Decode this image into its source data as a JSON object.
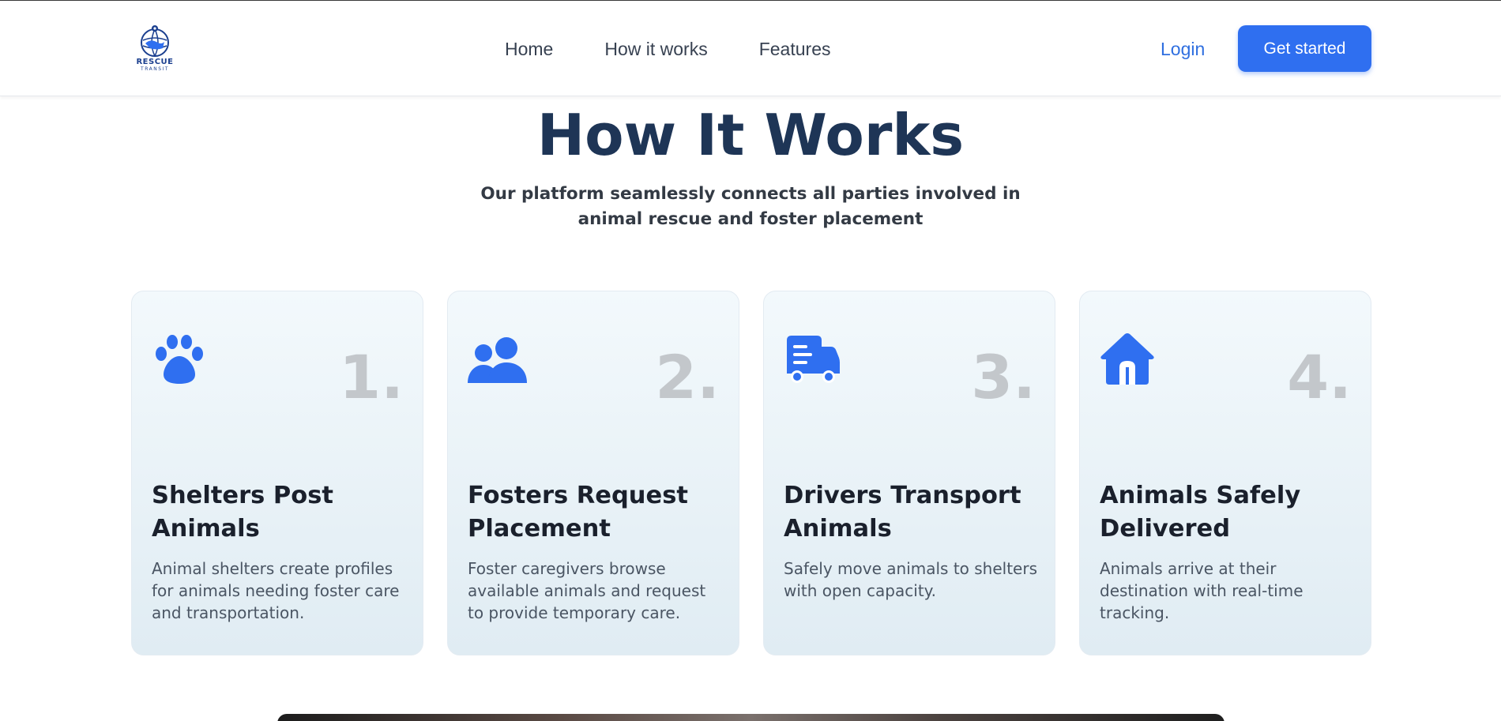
{
  "header": {
    "logo": {
      "brand": "RESCUE",
      "sub": "TRANSIT"
    },
    "nav": [
      {
        "label": "Home"
      },
      {
        "label": "How it works"
      },
      {
        "label": "Features"
      }
    ],
    "login_label": "Login",
    "cta_label": "Get started"
  },
  "colors": {
    "accent": "#2f6ff0",
    "heading": "#1e3556",
    "number_gray": "#c3c7cb"
  },
  "section": {
    "title": "How It Works",
    "subtitle": "Our platform seamlessly connects all parties involved in animal rescue and foster placement"
  },
  "steps": [
    {
      "number": "1.",
      "icon": "paw-icon",
      "title": "Shelters Post Animals",
      "description": "Animal shelters create profiles for animals needing foster care and transportation."
    },
    {
      "number": "2.",
      "icon": "users-icon",
      "title": "Fosters Request Placement",
      "description": "Foster caregivers browse available animals and request to provide temporary care."
    },
    {
      "number": "3.",
      "icon": "truck-icon",
      "title": "Drivers Transport Animals",
      "description": "Safely move animals to shelters with open capacity."
    },
    {
      "number": "4.",
      "icon": "home-icon",
      "title": "Animals Safely Delivered",
      "description": "Animals arrive at their destination with real-time tracking."
    }
  ]
}
